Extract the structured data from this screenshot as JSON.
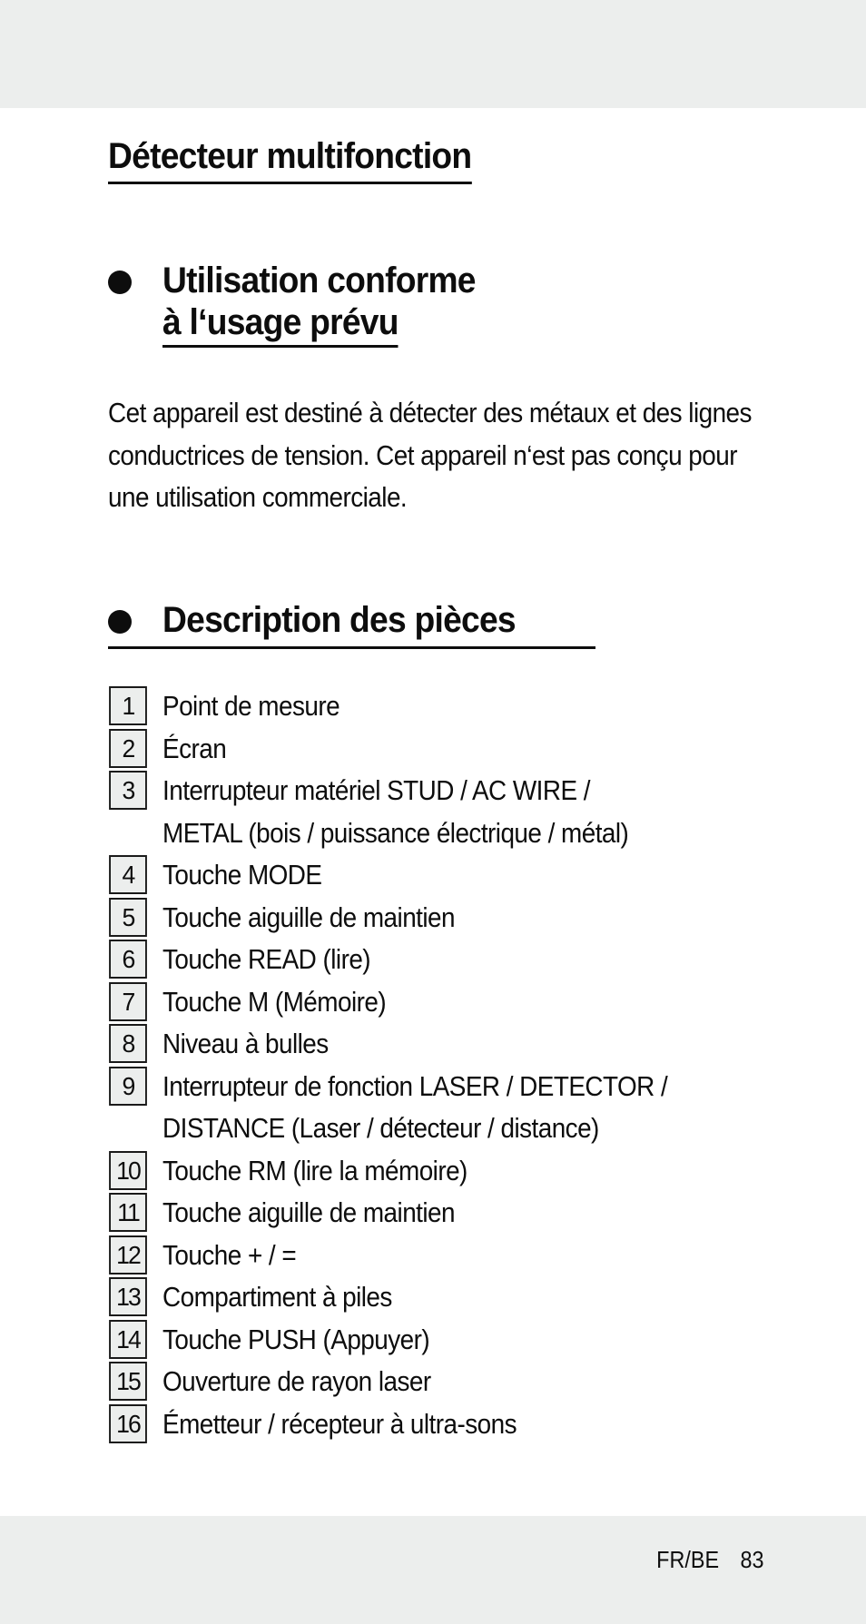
{
  "document": {
    "title": "Détecteur multifonction",
    "sections": [
      {
        "heading_line1": "Utilisation conforme",
        "heading_line2": "à l‘usage prévu",
        "paragraph": "Cet appareil est destiné à détecter des métaux et des lignes conductrices de tension. Cet appareil n‘est pas conçu pour une utilisation commerciale."
      },
      {
        "heading": "Description des pièces",
        "parts": [
          {
            "number": "1",
            "label": "Point de mesure"
          },
          {
            "number": "2",
            "label": "Écran"
          },
          {
            "number": "3",
            "label": "Interrupteur matériel STUD / AC WIRE /\nMETAL (bois / puissance électrique / métal)"
          },
          {
            "number": "4",
            "label": "Touche MODE"
          },
          {
            "number": "5",
            "label": "Touche aiguille de maintien"
          },
          {
            "number": "6",
            "label": "Touche READ (lire)"
          },
          {
            "number": "7",
            "label": "Touche M (Mémoire)"
          },
          {
            "number": "8",
            "label": "Niveau à bulles"
          },
          {
            "number": "9",
            "label": "Interrupteur de fonction LASER / DETECTOR /\nDISTANCE (Laser / détecteur / distance)"
          },
          {
            "number": "10",
            "label": "Touche RM (lire la mémoire)"
          },
          {
            "number": "11",
            "label": "Touche aiguille de maintien"
          },
          {
            "number": "12",
            "label": "Touche + / ="
          },
          {
            "number": "13",
            "label": "Compartiment à piles"
          },
          {
            "number": "14",
            "label": "Touche PUSH (Appuyer)"
          },
          {
            "number": "15",
            "label": "Ouverture de rayon laser"
          },
          {
            "number": "16",
            "label": "Émetteur / récepteur à ultra-sons"
          }
        ]
      }
    ]
  },
  "footer": {
    "locale": "FR/BE",
    "page_number": "83"
  },
  "colors": {
    "band": "#eceeed",
    "text": "#0d0d0d",
    "number_box_fill": "#eceeed"
  }
}
